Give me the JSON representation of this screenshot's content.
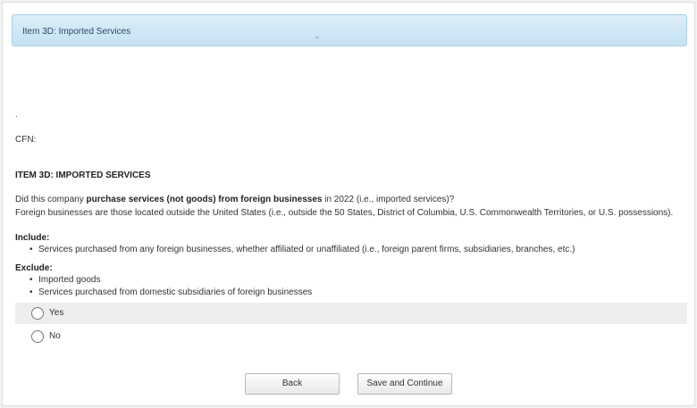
{
  "header": {
    "title": "Item 3D: Imported Services",
    "mark": "«"
  },
  "meta": {
    "dot": ".",
    "cfn_label": "CFN:"
  },
  "item": {
    "heading": "ITEM 3D: IMPORTED SERVICES",
    "question_prefix": "Did this company ",
    "question_bold": "purchase services (not goods) from foreign businesses",
    "question_suffix": " in 2022 (i.e., imported services)?",
    "definition": "Foreign businesses are those located outside the United States (i.e., outside the 50 States, District of Columbia, U.S. Commonwealth Territories, or U.S. possessions)."
  },
  "include": {
    "label": "Include:",
    "items": [
      "Services purchased from any foreign businesses, whether affiliated or unaffiliated (i.e., foreign parent firms, subsidiaries, branches, etc.)"
    ]
  },
  "exclude": {
    "label": "Exclude:",
    "items": [
      "Imported goods",
      "Services purchased from domestic subsidiaries of foreign businesses"
    ]
  },
  "options": [
    {
      "label": "Yes"
    },
    {
      "label": "No"
    }
  ],
  "buttons": {
    "back": "Back",
    "save_continue": "Save and Continue"
  }
}
